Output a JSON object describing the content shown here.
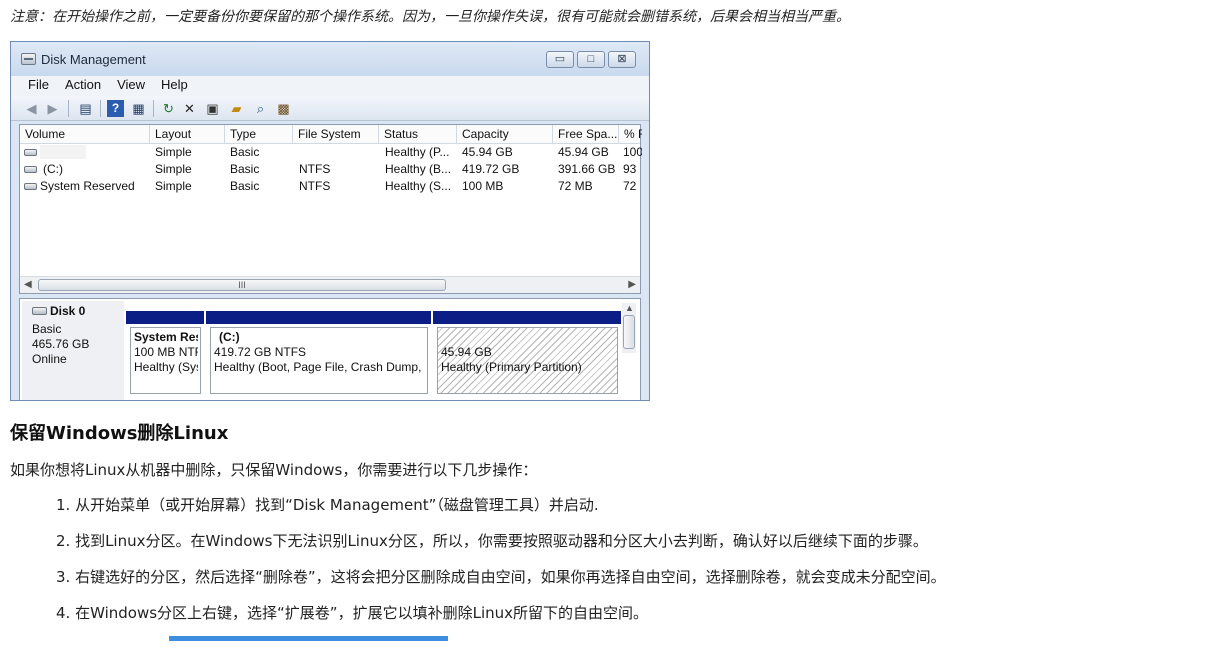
{
  "note": "注意：在开始操作之前，一定要备份你要保留的那个操作系统。因为，一旦你操作失误，很有可能就会删错系统，后果会相当相当严重。",
  "window": {
    "title": "Disk Management",
    "controls": {
      "minimize": "▭",
      "maximize": "□",
      "close": "⊠"
    },
    "menu": [
      "File",
      "Action",
      "View",
      "Help"
    ],
    "toolbar_icons": [
      "back-arrow-icon",
      "forward-arrow-icon",
      "console-tree-icon",
      "help-icon",
      "properties-view-icon",
      "refresh-icon",
      "delete-icon",
      "properties-icon",
      "open-icon",
      "search-icon",
      "settings-icon"
    ],
    "columns": [
      "Volume",
      "Layout",
      "Type",
      "File System",
      "Status",
      "Capacity",
      "Free Spa...",
      "% F"
    ],
    "rows": [
      {
        "volume": "",
        "layout": "Simple",
        "type": "Basic",
        "fs": "",
        "status": "Healthy (P...",
        "capacity": "45.94 GB",
        "free": "45.94 GB",
        "pct": "100"
      },
      {
        "volume": "(C:)",
        "layout": "Simple",
        "type": "Basic",
        "fs": "NTFS",
        "status": "Healthy (B...",
        "capacity": "419.72 GB",
        "free": "391.66 GB",
        "pct": "93"
      },
      {
        "volume": "System Reserved",
        "layout": "Simple",
        "type": "Basic",
        "fs": "NTFS",
        "status": "Healthy (S...",
        "capacity": "100 MB",
        "free": "72 MB",
        "pct": "72"
      }
    ],
    "scroll_grip": "III",
    "disk": {
      "name": "Disk 0",
      "type": "Basic",
      "size": "465.76 GB",
      "state": "Online",
      "partitions": [
        {
          "name": "System Res",
          "line1": "100 MB NTF",
          "line2": "Healthy (Sys"
        },
        {
          "name": "(C:)",
          "line1": "419.72 GB NTFS",
          "line2": "Healthy (Boot, Page File, Crash Dump, P"
        },
        {
          "name": "",
          "line1": "45.94 GB",
          "line2": "Healthy (Primary Partition)"
        }
      ]
    }
  },
  "heading": "保留Windows删除Linux",
  "intro": "如果你想将Linux从机器中删除，只保留Windows，你需要进行以下几步操作：",
  "steps": [
    "1. 从开始菜单（或开始屏幕）找到“Disk Management”（磁盘管理工具）并启动.",
    "2. 找到Linux分区。在Windows下无法识别Linux分区，所以，你需要按照驱动器和分区大小去判断，确认好以后继续下面的步骤。",
    "3. 右键选好的分区，然后选择“删除卷”，这将会把分区删除成自由空间，如果你再选择自由空间，选择删除卷，就会变成未分配空间。",
    "4. 在Windows分区上右键，选择“扩展卷”，扩展它以填补删除Linux所留下的自由空间。"
  ]
}
